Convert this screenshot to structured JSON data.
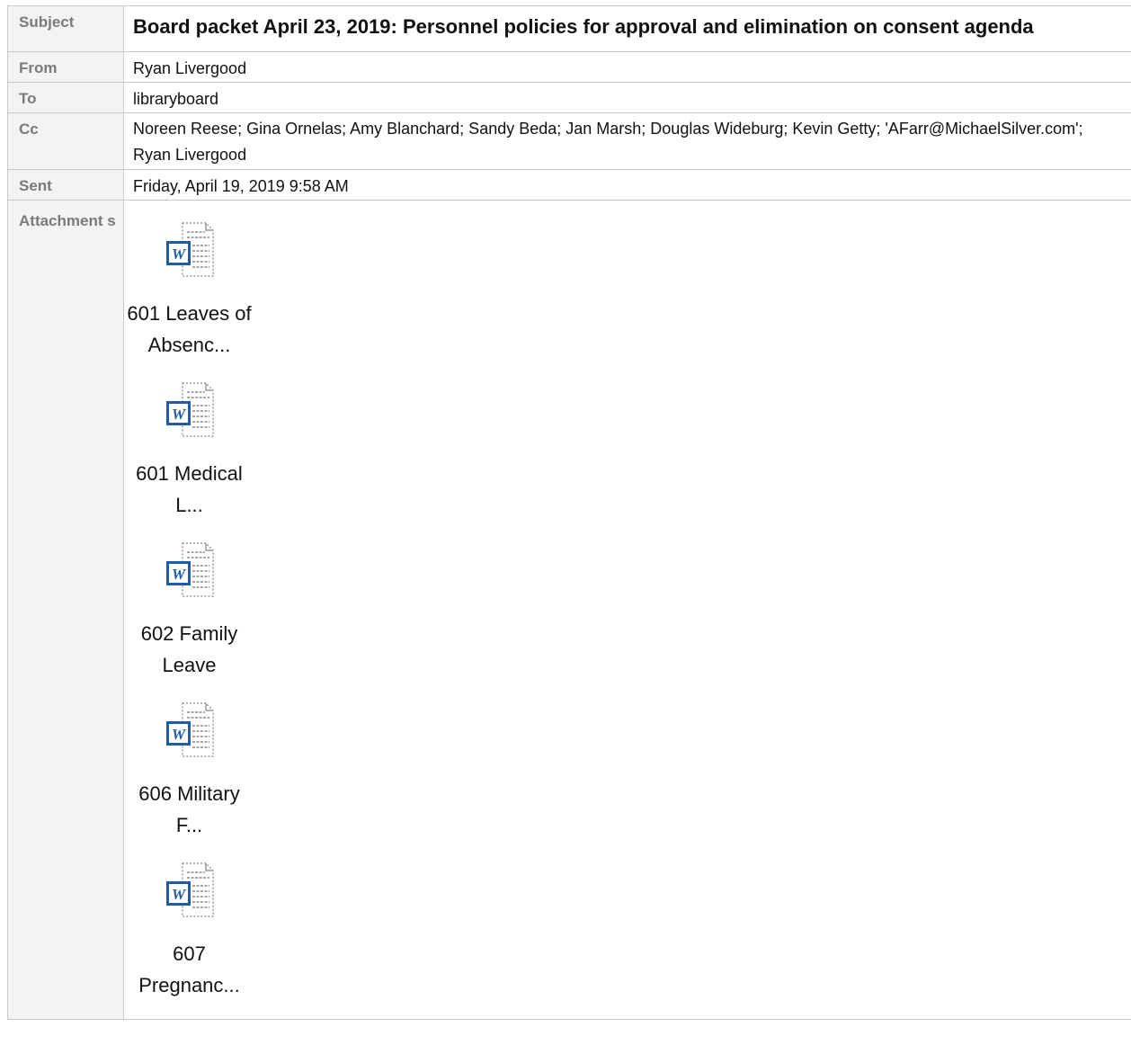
{
  "header": {
    "subject_label": "Subject",
    "subject": "Board packet April 23, 2019: Personnel policies for approval and elimination on consent agenda",
    "from_label": "From",
    "from": "Ryan Livergood",
    "to_label": "To",
    "to": "libraryboard",
    "cc_label": "Cc",
    "cc": "Noreen Reese; Gina Ornelas; Amy Blanchard; Sandy Beda; Jan Marsh; Douglas Wideburg; Kevin Getty; 'AFarr@MichaelSilver.com'; Ryan Livergood",
    "sent_label": "Sent",
    "sent": "Friday, April 19, 2019 9:58 AM",
    "attachments_label": "Attachment s"
  },
  "attachments": [
    {
      "name": "601 Leaves of Absenc...",
      "icon": "word-document-icon"
    },
    {
      "name": "601 Medical L...",
      "icon": "word-document-icon"
    },
    {
      "name": "602 Family Leave",
      "icon": "word-document-icon"
    },
    {
      "name": "606 Military F...",
      "icon": "word-document-icon"
    },
    {
      "name": "607 Pregnanc...",
      "icon": "word-document-icon"
    }
  ],
  "colors": {
    "label_bg": "#f3f3f3",
    "label_text": "#7a7a7a",
    "border": "#c9c9c9",
    "word_blue": "#1f5ba8"
  }
}
